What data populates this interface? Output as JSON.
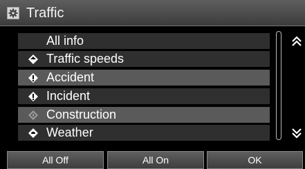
{
  "window": {
    "title": "Traffic",
    "icon": "settings-gear-icon"
  },
  "list": {
    "items": [
      {
        "label": "All info",
        "icon": "none",
        "style": "dark"
      },
      {
        "label": "Traffic speeds",
        "icon": "traffic-speeds-icon",
        "style": "dark"
      },
      {
        "label": "Accident",
        "icon": "accident-icon",
        "style": "light"
      },
      {
        "label": "Incident",
        "icon": "incident-icon",
        "style": "dark"
      },
      {
        "label": "Construction",
        "icon": "construction-icon",
        "style": "light"
      },
      {
        "label": "Weather",
        "icon": "weather-icon",
        "style": "dark"
      }
    ]
  },
  "buttons": {
    "all_off": "All Off",
    "all_on": "All On",
    "ok": "OK"
  },
  "colors": {
    "background": "#000000",
    "row_dark": "#2f2f2f",
    "row_light": "#5a5a5a",
    "text": "#ffffff"
  }
}
